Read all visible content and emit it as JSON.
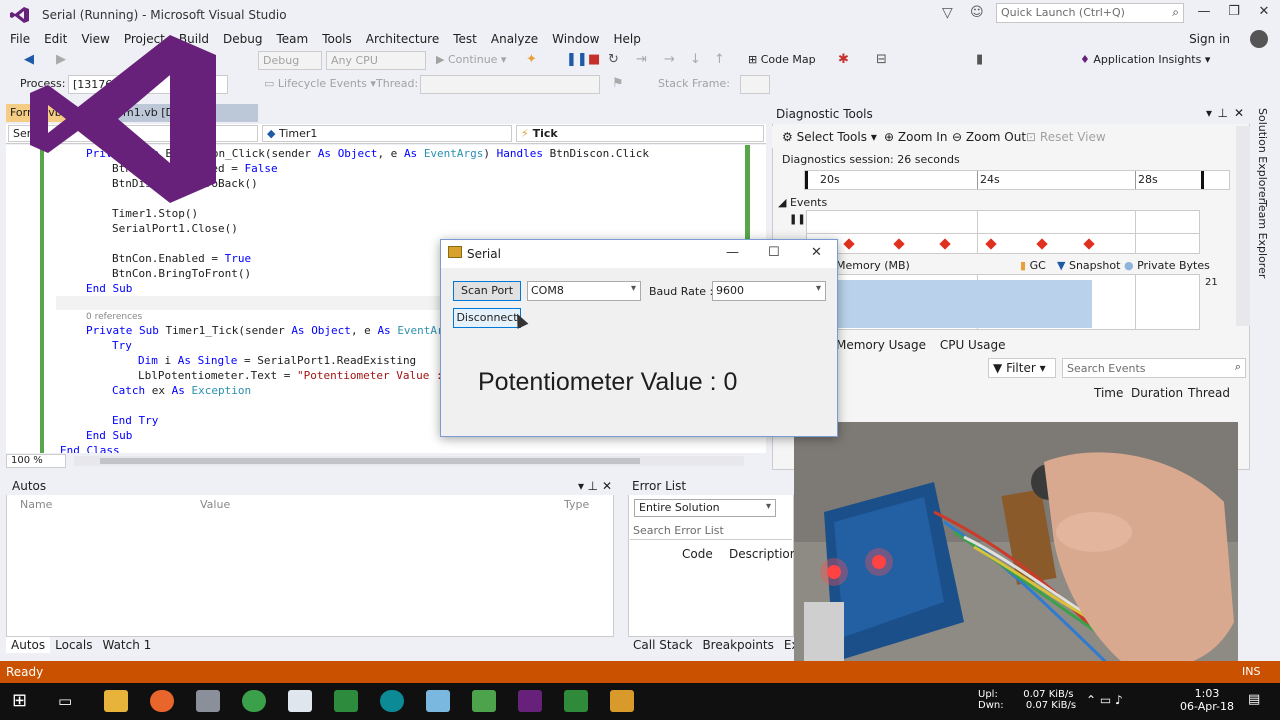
{
  "window": {
    "title": "Serial (Running) - Microsoft Visual Studio",
    "quick_launch_placeholder": "Quick Launch (Ctrl+Q)",
    "sign_in": "Sign in"
  },
  "menu": [
    "File",
    "Edit",
    "View",
    "Project",
    "Build",
    "Debug",
    "Team",
    "Tools",
    "Architecture",
    "Test",
    "Analyze",
    "Window",
    "Help"
  ],
  "toolbar": {
    "config": "Debug",
    "platform": "Any CPU",
    "continue": "Continue",
    "code_map": "Code Map",
    "app_insights": "Application Insights",
    "process_label": "Process:",
    "process_value": "[13176] Se",
    "lifecycle": "Lifecycle Events",
    "thread": "Thread:",
    "stack_frame": "Stack Frame:"
  },
  "editor": {
    "tab_active": "Form1.vb",
    "tab_other": "Form1.vb [Design]",
    "nav_left": "Serial",
    "nav_mid": "Timer1",
    "nav_right": "Tick",
    "zoom": "100 %",
    "refs": "0 references"
  },
  "diagnostics": {
    "title": "Diagnostic Tools",
    "select_tools": "Select Tools",
    "zoom_in": "Zoom In",
    "zoom_out": "Zoom Out",
    "reset_view": "Reset View",
    "session": "Diagnostics session: 26 seconds",
    "ticks": [
      "20s",
      "24s",
      "28s"
    ],
    "events_label": "Events",
    "memory_label": "Memory (MB)",
    "legend_gc": "GC",
    "legend_snapshot": "Snapshot",
    "legend_private": "Private Bytes",
    "memory_max": "21",
    "tab_memory": "Memory Usage",
    "tab_cpu": "CPU Usage",
    "filter": "Filter",
    "search_events": "Search Events",
    "col_time": "Time",
    "col_duration": "Duration",
    "col_thread": "Thread",
    "accent": "#e0301e"
  },
  "serial_form": {
    "title": "Serial",
    "scan_port": "Scan Port",
    "com_port": "COM8",
    "baud_label": "Baud Rate :",
    "baud_value": "9600",
    "disconnect": "Disconnect",
    "pot_value": "Potentiometer Value : 0"
  },
  "autos": {
    "title": "Autos",
    "col_name": "Name",
    "col_value": "Value",
    "col_type": "Type",
    "tabs": [
      "Autos",
      "Locals",
      "Watch 1"
    ]
  },
  "error_list": {
    "title": "Error List",
    "scope": "Entire Solution",
    "search": "Search Error List",
    "col_code": "Code",
    "col_desc": "Description",
    "tabs": [
      "Call Stack",
      "Breakpoints",
      "Exceptio"
    ]
  },
  "side_tabs": [
    "Solution Explorer",
    "Team Explorer"
  ],
  "status": {
    "text": "Ready",
    "ins": "INS",
    "color": "#ca5100"
  },
  "taskbar": {
    "upl": "Upl:",
    "upl_v": "0.07 KiB/s",
    "dwn": "Dwn:",
    "dwn_v": "0.07 KiB/s",
    "time": "1:03",
    "date": "06-Apr-18"
  }
}
